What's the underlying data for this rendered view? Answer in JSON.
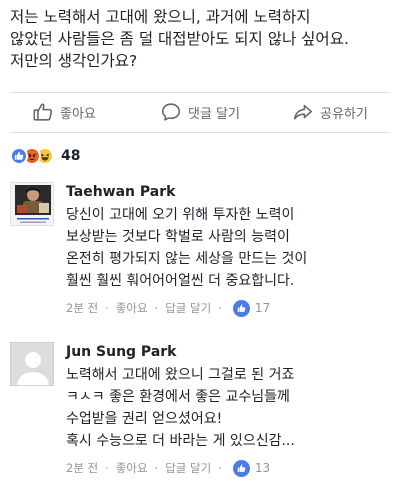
{
  "post": {
    "text_lines": [
      "저는 노력해서 고대에 왔으니, 과거에 노력하지",
      "않았던 사람들은 좀 덜 대접받아도 되지 않나 싶어요.",
      "저만의 생각인가요?"
    ]
  },
  "actions": {
    "like_label": "좋아요",
    "comment_label": "댓글 달기",
    "share_label": "공유하기"
  },
  "reactions": {
    "count": "48",
    "types": [
      "like-icon",
      "angry-icon",
      "haha-icon"
    ]
  },
  "comments": [
    {
      "name": "Taehwan Park",
      "text_lines": [
        "당신이 고대에 오기 위해 투자한 노력이",
        "보상받는 것보다 학벌로 사람의 능력이",
        "온전히 평가되지 않는 세상을 만드는 것이",
        "훨씬 훨씬 훠어어어얼씬 더 중요합니다."
      ],
      "time": "2분 전",
      "like_label": "좋아요",
      "reply_label": "답글 달기",
      "like_count": "17"
    },
    {
      "name": "Jun Sung Park",
      "text_lines": [
        "노력해서 고대에 왔으니 그걸로 된 거죠",
        "ㅋㅅㅋ 좋은 환경에서 좋은 교수님들께",
        "수업받을 권리 얻으셨어요!",
        "혹시 수능으로 더 바라는 게 있으신감..."
      ],
      "time": "2분 전",
      "like_label": "좋아요",
      "reply_label": "답글 달기",
      "like_count": "13"
    }
  ],
  "colors": {
    "accent": "#4a7cf0",
    "meta": "#90949c",
    "text": "#1d2129"
  }
}
